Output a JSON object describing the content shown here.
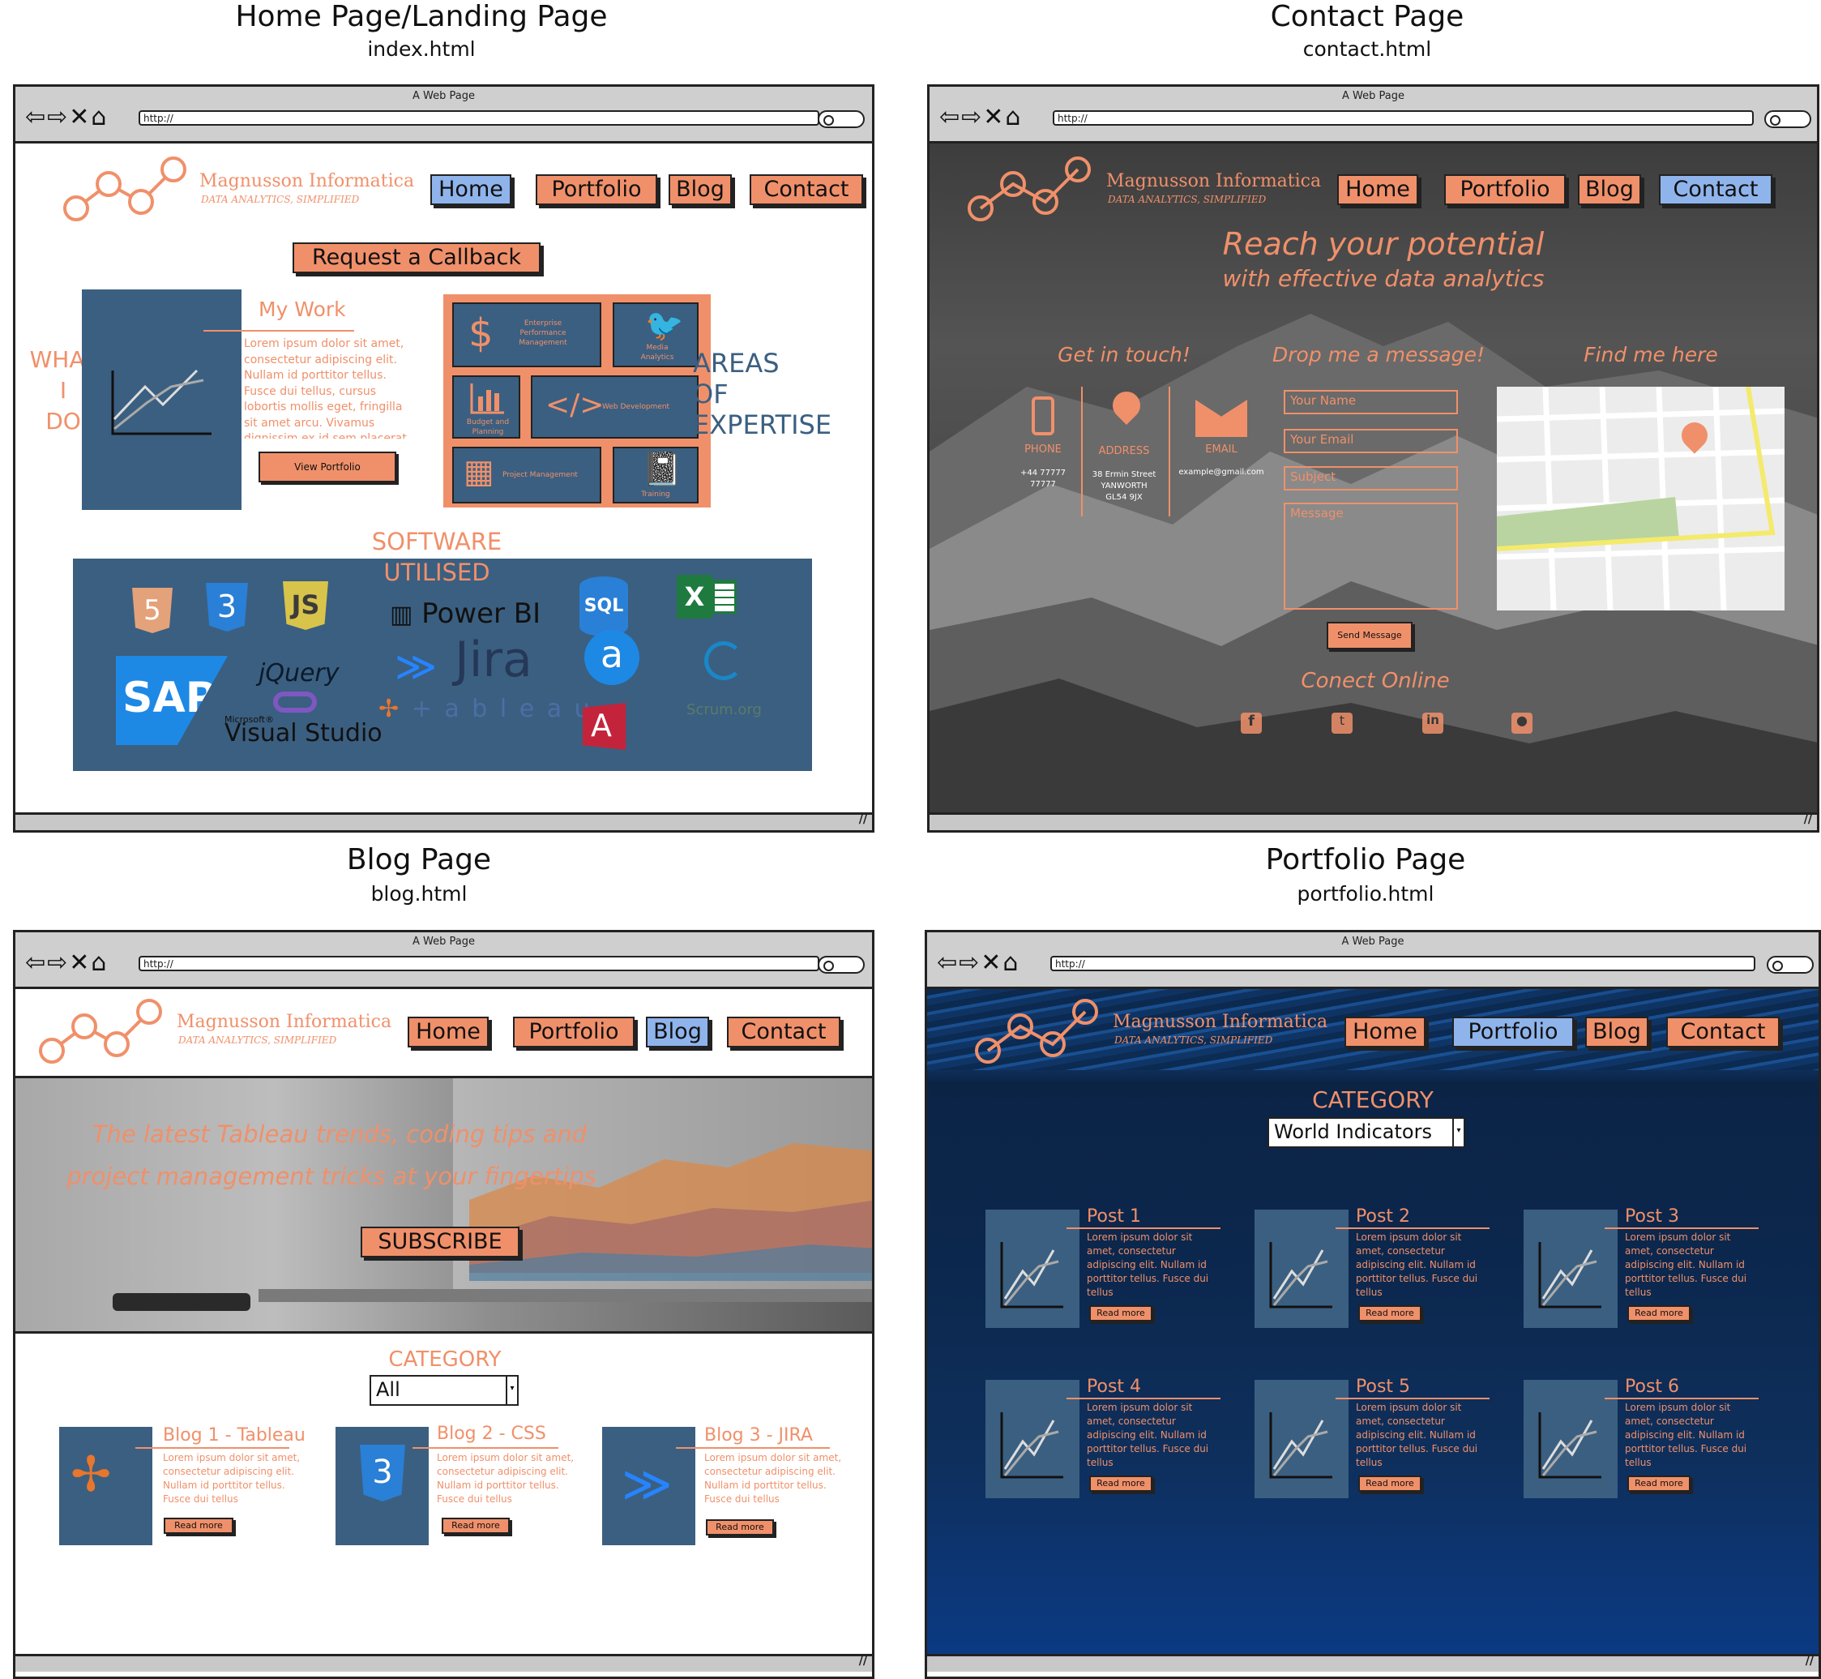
{
  "panels": {
    "home": {
      "heading": "Home Page/Landing Page",
      "file": "index.html"
    },
    "contact": {
      "heading": "Contact Page",
      "file": "contact.html"
    },
    "blog": {
      "heading": "Blog Page",
      "file": "blog.html"
    },
    "portfolio": {
      "heading": "Portfolio Page",
      "file": "portfolio.html"
    }
  },
  "browser": {
    "title": "A Web Page",
    "url": "http://",
    "nav_glyphs": "⇦⇨✕⌂"
  },
  "brand": {
    "name": "Magnusson Informatica",
    "tagline": "DATA ANALYTICS, SIMPLIFIED"
  },
  "nav": {
    "home": "Home",
    "portfolio": "Portfolio",
    "blog": "Blog",
    "contact": "Contact"
  },
  "home": {
    "callback": "Request a Callback",
    "what_i_do": [
      "WHAT",
      "I",
      "DO"
    ],
    "my_work": "My Work",
    "my_work_body": "Lorem ipsum dolor sit amet, consectetur adipiscing elit. Nullam id porttitor tellus. Fusce dui tellus, cursus lobortis mollis eget, fringilla sit amet arcu. Vivamus dignissim ex id sem placerat",
    "view_portfolio": "View Portfolio",
    "areas": [
      "AREAS",
      "OF",
      "EXPERTISE"
    ],
    "tiles": {
      "epm": "Enterprise Performance Management",
      "media": "Media Analytics",
      "budget": "Budget and Planning",
      "web": "Web Development",
      "pm": "Project Management",
      "training": "Training"
    },
    "software": [
      "SOFTWARE",
      "UTILISED"
    ],
    "logos": {
      "html5": "5",
      "css3": "3",
      "js": "JS",
      "powerbi": "Power BI",
      "sql": "SQL",
      "excel": "X",
      "sap": "SAP",
      "jquery": "jQuery",
      "jira": "Jira",
      "alteryx": "a",
      "scrum": "Scrum.org",
      "tableau": "+ a b l e a u",
      "vs_small": "Microsoft®",
      "vs": "Visual Studio",
      "access": "A"
    }
  },
  "contact": {
    "hero_title": "Reach your potential",
    "hero_sub": "with effective data analytics",
    "col_touch": "Get in touch!",
    "col_message": "Drop me a message!",
    "col_find": "Find me here",
    "phone_label": "PHONE",
    "phone_value": "+44 77777 77777",
    "address_label": "ADDRESS",
    "address_value": "38 Ermin Street YANWORTH GL54 9JX",
    "email_label": "EMAIL",
    "email_value": "example@gmail.com",
    "fields": {
      "name": "Your Name",
      "email": "Your Email",
      "subject": "Subject",
      "message": "Message"
    },
    "send": "Send Message",
    "connect": "Conect Online"
  },
  "blog": {
    "hero_line1": "The latest Tableau trends, coding tips and",
    "hero_line2": "project management tricks at your fingertips",
    "subscribe": "SUBSCRIBE",
    "category_label": "CATEGORY",
    "category_value": "All",
    "posts": [
      {
        "title": "Blog 1 - Tableau",
        "body": "Lorem ipsum dolor sit amet, consectetur adipiscing elit. Nullam id porttitor tellus. Fusce dui tellus",
        "more": "Read more"
      },
      {
        "title": "Blog 2 - CSS",
        "body": "Lorem ipsum dolor sit amet, consectetur adipiscing elit. Nullam id porttitor tellus. Fusce dui tellus",
        "more": "Read more"
      },
      {
        "title": "Blog 3 - JIRA",
        "body": "Lorem ipsum dolor sit amet, consectetur adipiscing elit. Nullam id porttitor tellus. Fusce dui tellus",
        "more": "Read more"
      }
    ]
  },
  "portfolio": {
    "category_label": "CATEGORY",
    "category_value": "World Indicators",
    "posts": [
      {
        "title": "Post 1",
        "body": "Lorem ipsum dolor sit amet, consectetur adipiscing elit. Nullam id porttitor tellus. Fusce dui tellus",
        "more": "Read more"
      },
      {
        "title": "Post 2",
        "body": "Lorem ipsum dolor sit amet, consectetur adipiscing elit. Nullam id porttitor tellus. Fusce dui tellus",
        "more": "Read more"
      },
      {
        "title": "Post 3",
        "body": "Lorem ipsum dolor sit amet, consectetur adipiscing elit. Nullam id porttitor tellus. Fusce dui tellus",
        "more": "Read more"
      },
      {
        "title": "Post 4",
        "body": "Lorem ipsum dolor sit amet, consectetur adipiscing elit. Nullam id porttitor tellus. Fusce dui tellus",
        "more": "Read more"
      },
      {
        "title": "Post 5",
        "body": "Lorem ipsum dolor sit amet, consectetur adipiscing elit. Nullam id porttitor tellus. Fusce dui tellus",
        "more": "Read more"
      },
      {
        "title": "Post 6",
        "body": "Lorem ipsum dolor sit amet, consectetur adipiscing elit. Nullam id porttitor tellus. Fusce dui tellus",
        "more": "Read more"
      }
    ]
  },
  "colors": {
    "accent": "#f0906a",
    "tile": "#3b5f80",
    "active_nav": "#8fb4ec"
  }
}
